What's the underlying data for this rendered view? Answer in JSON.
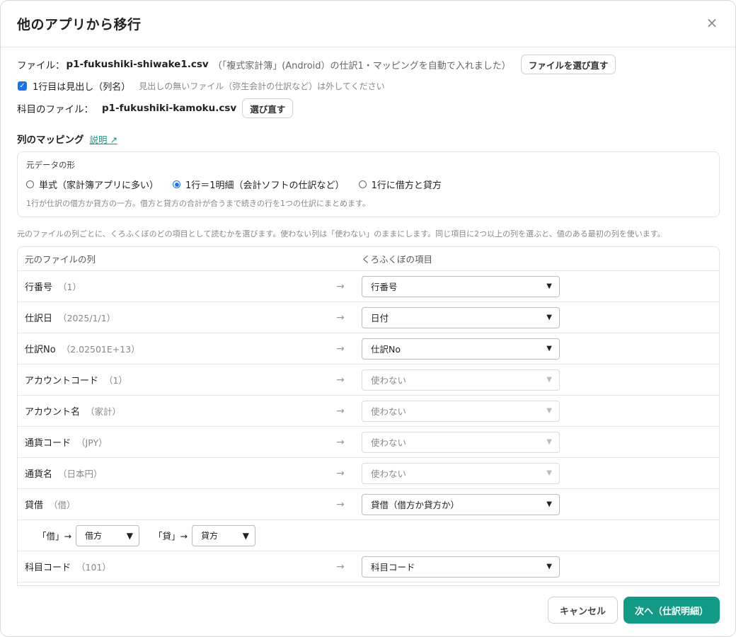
{
  "dialog": {
    "title": "他のアプリから移行",
    "close_symbol": "×"
  },
  "file": {
    "label": "ファイル：",
    "name": "p1-fukushiki-shiwake1.csv",
    "note": "（「複式家計簿」(Android）の仕訳1・マッピングを自動で入れました）",
    "reselect_label": "ファイルを選び直す"
  },
  "header_option": {
    "checked": true,
    "label": "1行目は見出し（列名）",
    "hint": "見出しの無いファイル（弥生会計の仕訳など）は外してください"
  },
  "kamoku": {
    "label": "科目のファイル：",
    "name": "p1-fukushiki-kamoku.csv",
    "reselect_label": "選び直す"
  },
  "mapping": {
    "title": "列のマッピング",
    "help_link": "説明 ↗",
    "shape_caption": "元データの形",
    "shape_options": [
      {
        "label": "単式（家計簿アプリに多い）",
        "selected": false
      },
      {
        "label": "1行＝1明細（会計ソフトの仕訳など）",
        "selected": true
      },
      {
        "label": "1行に借方と貸方",
        "selected": false
      }
    ],
    "shape_desc": "1行が仕訳の借方か貸方の一方。借方と貸方の合計が合うまで続きの行を1つの仕訳にまとめます。",
    "intro": "元のファイルの列ごとに、くろふくぼのどの項目として読むかを選びます。使わない列は「使わない」のままにします。同じ項目に2つ以上の列を選ぶと、値のある最初の列を使います。",
    "col_source_header": "元のファイルの列",
    "col_target_header": "くろふくぼの項目",
    "arrow": "→",
    "rows": [
      {
        "name": "行番号",
        "sample": "（1）",
        "target": "行番号",
        "used": true
      },
      {
        "name": "仕訳日",
        "sample": "（2025/1/1）",
        "target": "日付",
        "used": true
      },
      {
        "name": "仕訳No",
        "sample": "（2.02501E+13）",
        "target": "仕訳No",
        "used": true
      },
      {
        "name": "アカウントコード",
        "sample": "（1）",
        "target": "使わない",
        "used": false
      },
      {
        "name": "アカウント名",
        "sample": "（家計）",
        "target": "使わない",
        "used": false
      },
      {
        "name": "通貨コード",
        "sample": "（JPY）",
        "target": "使わない",
        "used": false
      },
      {
        "name": "通貨名",
        "sample": "（日本円）",
        "target": "使わない",
        "used": false
      },
      {
        "name": "貸借",
        "sample": "（借）",
        "target": "貸借（借方か貸方か）",
        "used": true
      }
    ],
    "debit_credit": {
      "debit_label": "「借」→",
      "debit_value": "借方",
      "credit_label": "「貸」→",
      "credit_value": "貸方"
    },
    "last_row": {
      "name": "科目コード",
      "sample": "（101）",
      "target": "科目コード",
      "used": true
    }
  },
  "footer": {
    "cancel_label": "キャンセル",
    "next_label": "次へ（仕訳明細）"
  }
}
